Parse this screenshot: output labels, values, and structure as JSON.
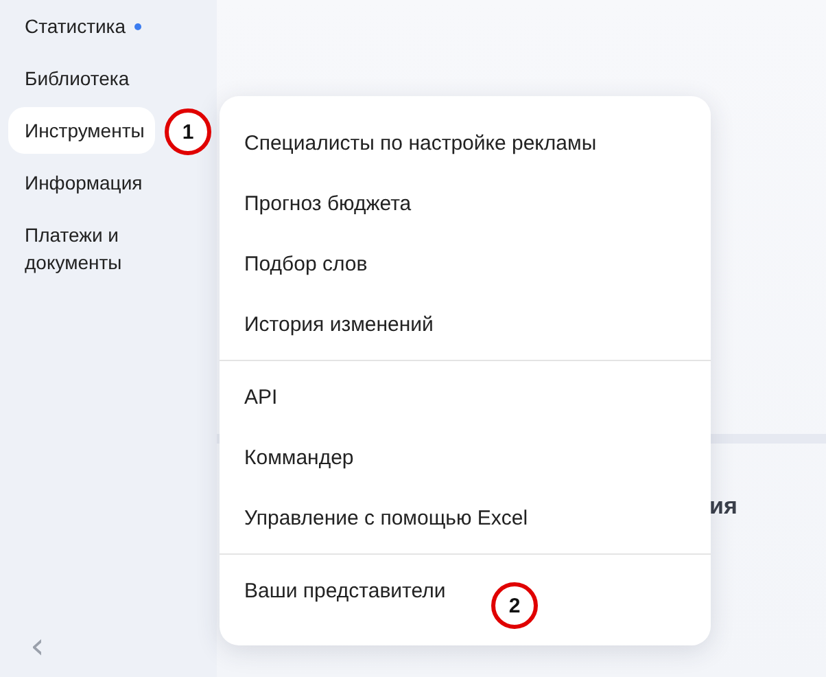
{
  "sidebar": {
    "items": [
      {
        "label": "Статистика",
        "selected": false,
        "dot": true
      },
      {
        "label": "Библиотека",
        "selected": false,
        "dot": false
      },
      {
        "label": "Инструменты",
        "selected": true,
        "dot": false
      },
      {
        "label": "Информация",
        "selected": false,
        "dot": false
      },
      {
        "label": "Платежи и документы",
        "selected": false,
        "dot": false
      }
    ],
    "collapse": "‹"
  },
  "main": {
    "heading_fragment": "ия"
  },
  "menu": {
    "groups": [
      [
        "Специалисты по настройке рекламы",
        "Прогноз бюджета",
        "Подбор слов",
        "История изменений"
      ],
      [
        "API",
        "Коммандер",
        "Управление с помощью Excel"
      ],
      [
        "Ваши представители"
      ]
    ]
  },
  "callouts": [
    {
      "number": "1"
    },
    {
      "number": "2"
    }
  ]
}
